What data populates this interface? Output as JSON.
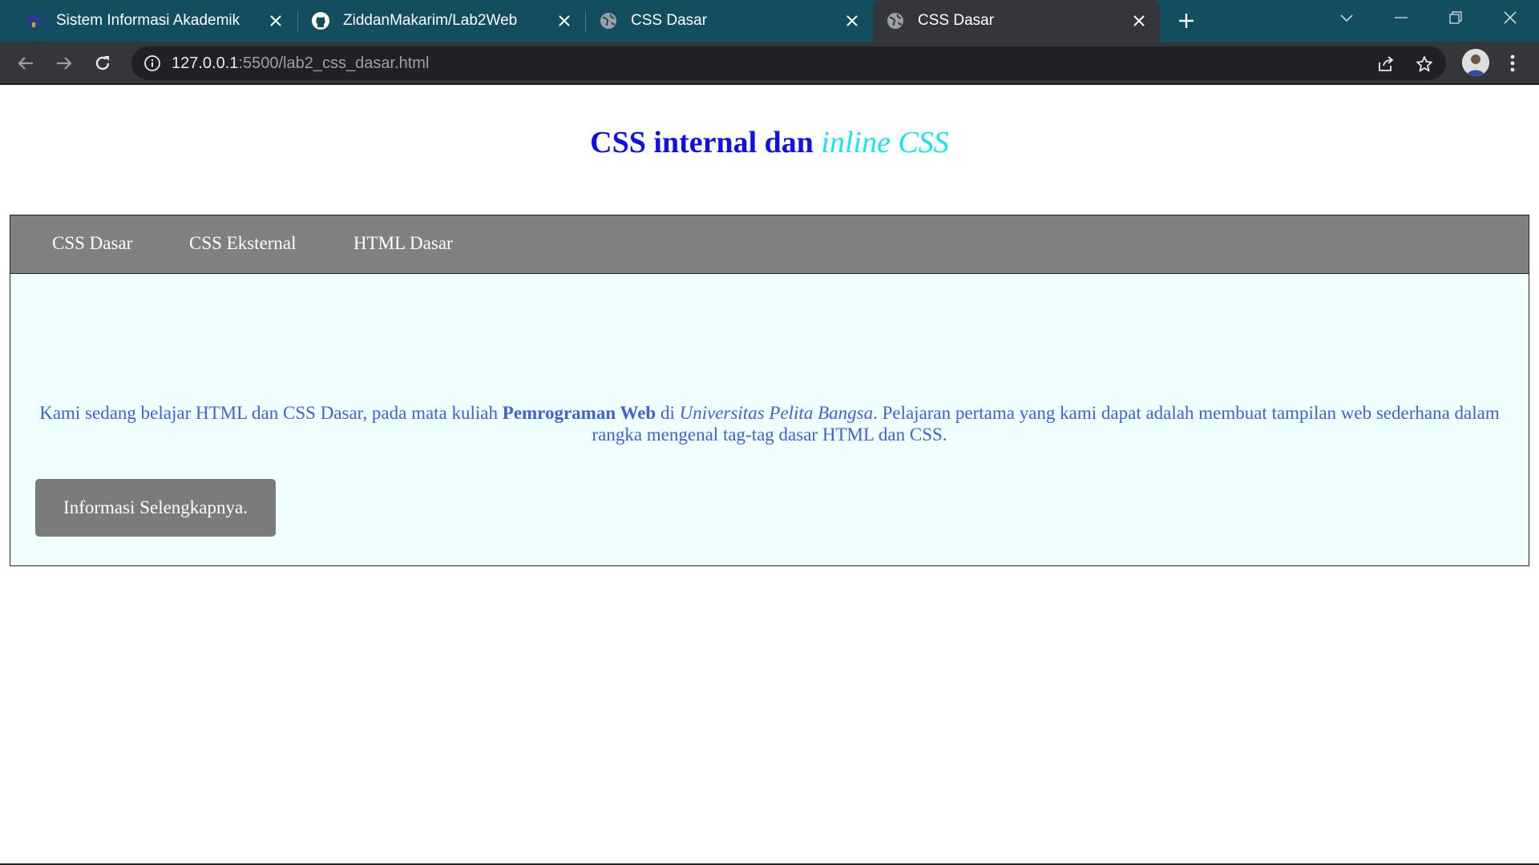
{
  "browser": {
    "tabs": [
      {
        "title": "Sistem Informasi Akademik",
        "icon": "campus-logo-icon",
        "active": false
      },
      {
        "title": "ZiddanMakarim/Lab2Web",
        "icon": "github-icon",
        "active": false
      },
      {
        "title": "CSS Dasar",
        "icon": "globe-icon",
        "active": false
      },
      {
        "title": "CSS Dasar",
        "icon": "globe-icon",
        "active": true
      }
    ],
    "url": {
      "host": "127.0.0.1",
      "rest": ":5500/lab2_css_dasar.html"
    }
  },
  "page": {
    "heading_main": "CSS internal dan ",
    "heading_em": "inline CSS",
    "nav": [
      {
        "label": "CSS Dasar"
      },
      {
        "label": "CSS Eksternal"
      },
      {
        "label": "HTML Dasar"
      }
    ],
    "paragraph": {
      "part1": "Kami sedang belajar HTML dan CSS Dasar, pada mata kuliah ",
      "bold": "Pemrograman Web",
      "part2": " di ",
      "italic": "Universitas Pelita Bangsa",
      "part3": ". Pelajaran pertama yang kami dapat adalah membuat tampilan web sederhana dalam rangka mengenal tag-tag dasar HTML dan CSS."
    },
    "button_label": "Informasi Selengkapnya."
  },
  "colors": {
    "heading": "#1010e6",
    "heading_em": "#12e6f4",
    "nav_bg": "#808080",
    "content_bg": "#eefffe",
    "paragraph": "#3f62d4",
    "button_bg": "#7b7b7b"
  }
}
